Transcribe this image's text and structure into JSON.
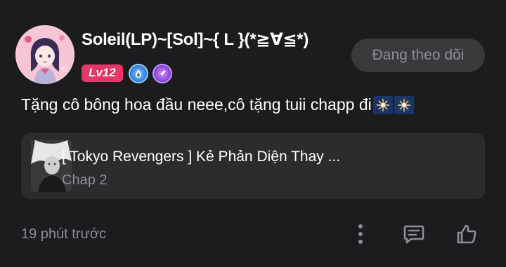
{
  "comment": {
    "username": "Soleil(LP)~[Sol]~{ L }(*≧∀≦*)",
    "level_badge": "Lv12",
    "follow_button_label": "Đang theo dõi",
    "text": "Tặng cô bông hoa đầu neee,cô tặng tuii chapp đi",
    "emojis": [
      "sparkler-emoji",
      "sparkler-emoji"
    ],
    "timestamp": "19 phút trước"
  },
  "manga": {
    "title": "[ Tokyo Revengers ] Kẻ Phản Diện Thay ...",
    "chapter": "Chap 2"
  },
  "icons": {
    "badge_1": "blue-drop-badge-icon",
    "badge_2": "purple-pen-badge-icon",
    "more": "more-vertical-icon",
    "reply": "comment-icon",
    "like": "thumbs-up-icon"
  },
  "colors": {
    "background": "#1c1c1e",
    "card": "#2c2c2e",
    "level_badge": "#e8366b",
    "muted_text": "#8e8e93",
    "follow_button_bg": "#3a3a3c"
  }
}
